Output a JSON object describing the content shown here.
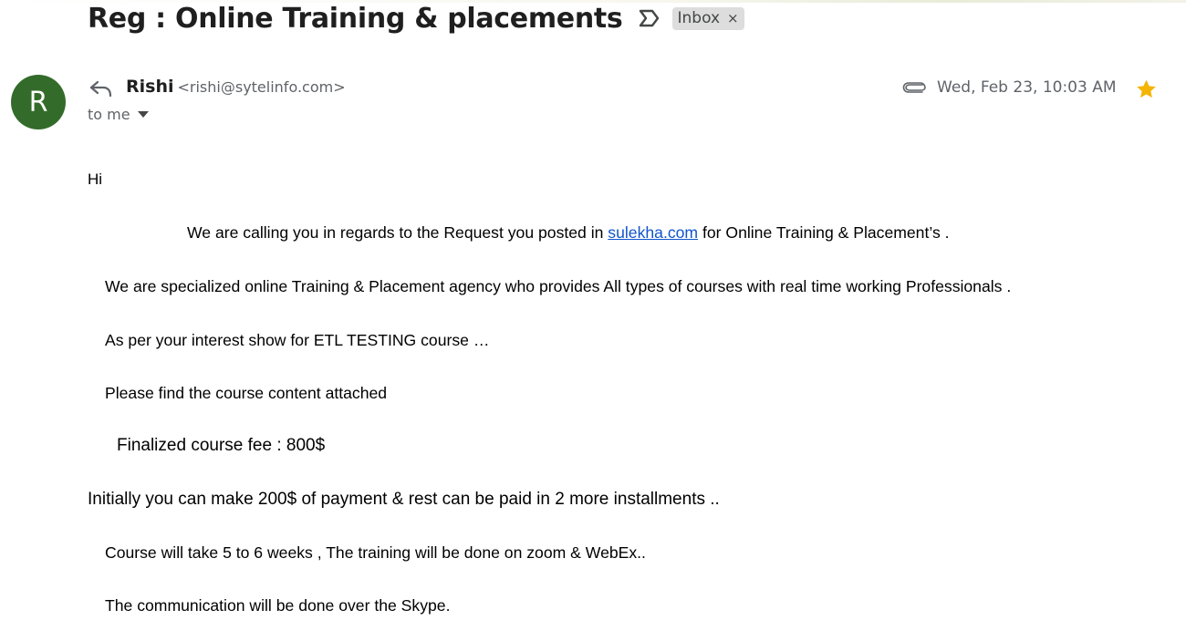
{
  "email": {
    "subject": "Reg : Online Training & placements",
    "label": "Inbox",
    "label_remove": "×",
    "sender": {
      "avatar_letter": "R",
      "avatar_color": "#336c2a",
      "name": "Rishi",
      "email": "<rishi@sytelinfo.com>"
    },
    "recipient": "to me",
    "date": "Wed, Feb 23, 10:03 AM",
    "starred": true,
    "has_attachment": true,
    "icons": {
      "important": "importance-marker-icon",
      "reply": "reply-icon",
      "attachment": "paperclip-icon",
      "star": "star-icon",
      "expand": "chevron-down-icon"
    },
    "body": {
      "greeting": "Hi",
      "line1_before": "We are calling you in regards to the Request you posted in ",
      "line1_link": "sulekha.com",
      "line1_after": " for Online Training & Placement’s .",
      "line2": "We are specialized  online Training & Placement agency who  provides All types of courses with real time working Professionals .",
      "line3": "As per your interest show for ETL TESTING course …",
      "line4": "Please find the course content attached",
      "line5": "Finalized course fee : 800$",
      "line6": "Initially you can make 200$ of payment & rest can be paid in 2 more installments ..",
      "line7": "Course will take 5 to 6 weeks , The training will be done on zoom & WebEx..",
      "line8": "The communication will be done over the Skype."
    }
  },
  "colors": {
    "link": "#1155cc",
    "star": "#f4b400",
    "label_bg": "#dddddd"
  }
}
